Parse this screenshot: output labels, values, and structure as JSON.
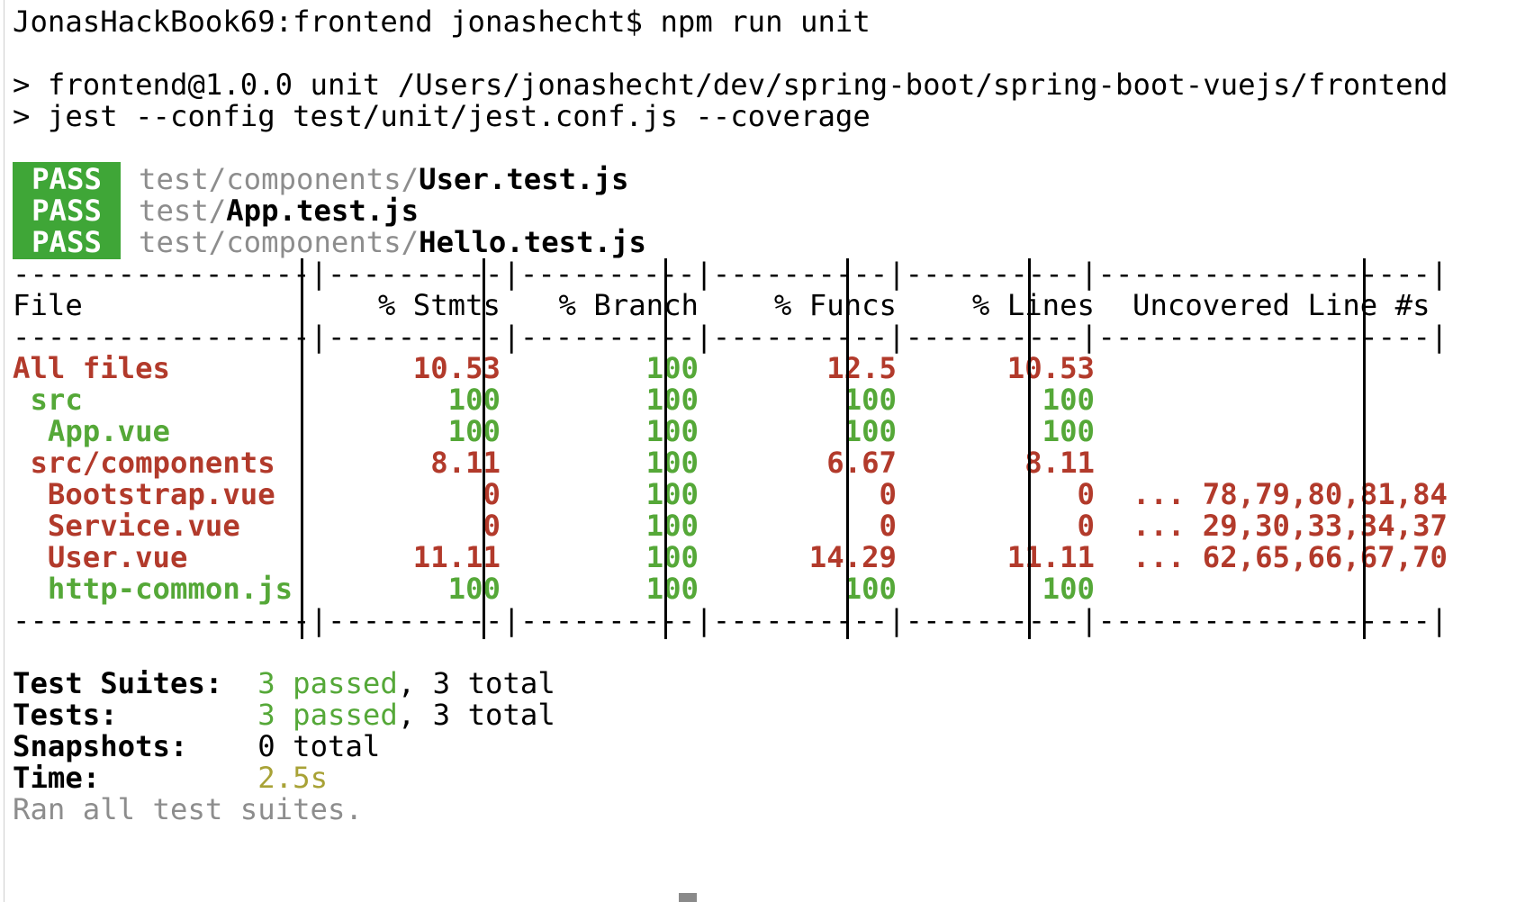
{
  "terminal": {
    "command_line": "JonasHackBook69:frontend jonashecht$ npm run unit",
    "script_info": "> frontend@1.0.0 unit /Users/jonashecht/dev/spring-boot/spring-boot-vuejs/frontend",
    "jest_cmd": "> jest --config test/unit/jest.conf.js --coverage",
    "results": [
      {
        "badge": "PASS",
        "dir": "test/components/",
        "file": "User.test.js"
      },
      {
        "badge": "PASS",
        "dir": "test/",
        "file": "App.test.js"
      },
      {
        "badge": "PASS",
        "dir": "test/components/",
        "file": "Hello.test.js"
      }
    ],
    "coverage": {
      "border": "-----------------|----------|----------|----------|----------|-------------------|",
      "headers": {
        "file": "File",
        "stmts": "% Stmts",
        "branch": "% Branch",
        "funcs": "% Funcs",
        "lines": "% Lines",
        "uncovered": "Uncovered Line #s"
      },
      "rows": [
        {
          "file": "All files",
          "stmts": "10.53",
          "branch": "100",
          "funcs": "12.5",
          "lines": "10.53",
          "uncovered": ""
        },
        {
          "file": " src",
          "stmts": "100",
          "branch": "100",
          "funcs": "100",
          "lines": "100",
          "uncovered": ""
        },
        {
          "file": "  App.vue",
          "stmts": "100",
          "branch": "100",
          "funcs": "100",
          "lines": "100",
          "uncovered": ""
        },
        {
          "file": " src/components",
          "stmts": "8.11",
          "branch": "100",
          "funcs": "6.67",
          "lines": "8.11",
          "uncovered": ""
        },
        {
          "file": "  Bootstrap.vue",
          "stmts": "0",
          "branch": "100",
          "funcs": "0",
          "lines": "0",
          "uncovered": "... 78,79,80,81,84"
        },
        {
          "file": "  Service.vue",
          "stmts": "0",
          "branch": "100",
          "funcs": "0",
          "lines": "0",
          "uncovered": "... 29,30,33,34,37"
        },
        {
          "file": "  User.vue",
          "stmts": "11.11",
          "branch": "100",
          "funcs": "14.29",
          "lines": "11.11",
          "uncovered": "... 62,65,66,67,70"
        },
        {
          "file": "  http-common.js",
          "stmts": "100",
          "branch": "100",
          "funcs": "100",
          "lines": "100",
          "uncovered": ""
        }
      ]
    },
    "summary": {
      "suites_label": "Test Suites:",
      "suites_passed": "3 passed",
      "suites_total": ", 3 total",
      "tests_label": "Tests:",
      "tests_passed": "3 passed",
      "tests_total": ", 3 total",
      "snapshots_label": "Snapshots:",
      "snapshots_value": "0 total",
      "time_label": "Time:",
      "time_value": "2.5s",
      "ran_all": "Ran all test suites."
    },
    "colors": {
      "pass_badge": "#3fa637",
      "good": "#55a838",
      "bad": "#b23a2b",
      "time": "#a8a236",
      "dim": "#8d8d8d"
    }
  }
}
